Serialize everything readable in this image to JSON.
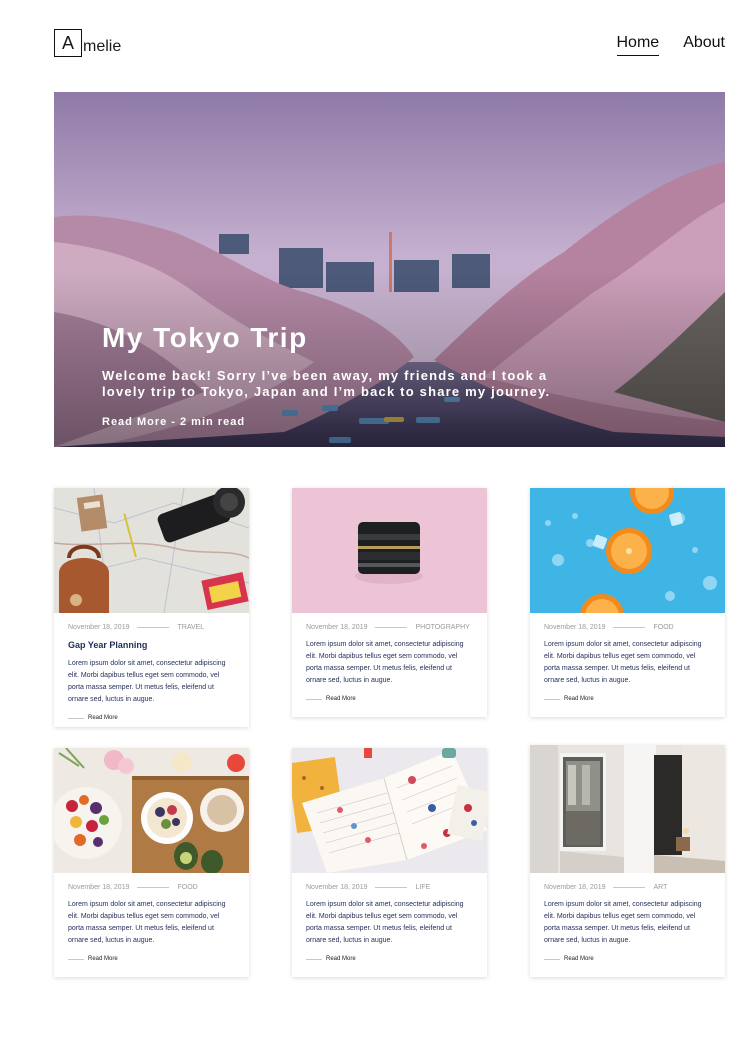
{
  "header": {
    "logo_initial": "A",
    "logo_rest": "melie",
    "nav": [
      {
        "label": "Home",
        "active": true
      },
      {
        "label": "About",
        "active": false
      }
    ]
  },
  "hero": {
    "title": "My Tokyo Trip",
    "text": "Welcome back! Sorry I’ve been away, my friends and I took a lovely trip to Tokyo, Japan and I’m back to share my journey.",
    "read_more": "Read More - 2 min read"
  },
  "posts": [
    {
      "date": "November 18, 2019",
      "category": "TRAVEL",
      "title": "Gap Year Planning",
      "excerpt": "Lorem ipsum dolor sit amet, consectetur adipiscing elit. Morbi dapibus tellus eget sem commodo, vel porta massa semper. Ut metus felis, eleifend ut ornare sed, luctus in augue.",
      "read_more": "Read More",
      "image": "map-camera-flatlay"
    },
    {
      "date": "November 18, 2019",
      "category": "PHOTOGRAPHY",
      "title": "",
      "excerpt": "Lorem ipsum dolor sit amet, consectetur adipiscing elit. Morbi dapibus tellus eget sem commodo, vel porta massa semper. Ut metus felis, eleifend ut ornare sed, luctus in augue.",
      "read_more": "Read More",
      "image": "camera-lens-on-pink"
    },
    {
      "date": "November 18, 2019",
      "category": "FOOD",
      "title": "",
      "excerpt": "Lorem ipsum dolor sit amet, consectetur adipiscing elit. Morbi dapibus tellus eget sem commodo, vel porta massa semper. Ut metus felis, eleifend ut ornare sed, luctus in augue.",
      "read_more": "Read More",
      "image": "oranges-on-blue"
    },
    {
      "date": "November 18, 2019",
      "category": "FOOD",
      "title": "",
      "excerpt": "Lorem ipsum dolor sit amet, consectetur adipiscing elit. Morbi dapibus tellus eget sem commodo, vel porta massa semper. Ut metus felis, eleifend ut ornare sed, luctus in augue.",
      "read_more": "Read More",
      "image": "breakfast-table"
    },
    {
      "date": "November 18, 2019",
      "category": "LIFE",
      "title": "",
      "excerpt": "Lorem ipsum dolor sit amet, consectetur adipiscing elit. Morbi dapibus tellus eget sem commodo, vel porta massa semper. Ut metus felis, eleifend ut ornare sed, luctus in augue.",
      "read_more": "Read More",
      "image": "open-journal"
    },
    {
      "date": "November 18, 2019",
      "category": "ART",
      "title": "",
      "excerpt": "Lorem ipsum dolor sit amet, consectetur adipiscing elit. Morbi dapibus tellus eget sem commodo, vel porta massa semper. Ut metus felis, eleifend ut ornare sed, luctus in augue.",
      "read_more": "Read More",
      "image": "gallery-interior"
    }
  ],
  "colors": {
    "text": "#111111",
    "title_navy": "#1f2f5a",
    "meta_gray": "#9a9a9a"
  }
}
